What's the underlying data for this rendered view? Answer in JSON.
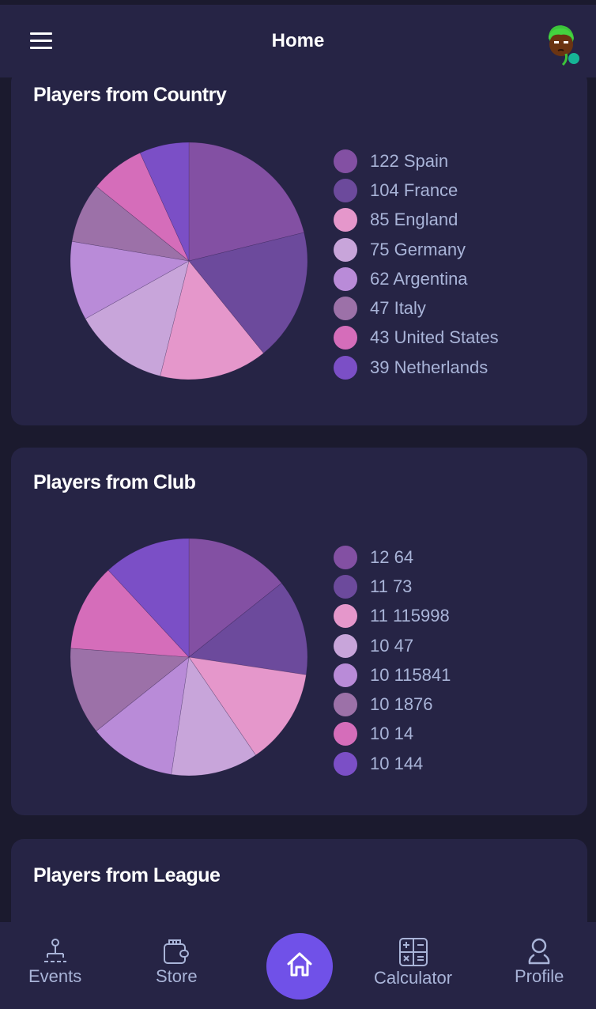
{
  "header": {
    "title": "Home",
    "menu_icon": "hamburger-icon",
    "avatar_icon": "user-avatar",
    "online_status_color": "#16b596"
  },
  "cards": [
    {
      "title": "Players from Country"
    },
    {
      "title": "Players from Club"
    },
    {
      "title": "Players from League"
    }
  ],
  "nav": {
    "items": [
      {
        "label": "Events",
        "icon": "events-icon"
      },
      {
        "label": "Store",
        "icon": "wallet-icon"
      },
      {
        "label": "Home",
        "icon": "home-icon"
      },
      {
        "label": "Calculator",
        "icon": "calculator-icon"
      },
      {
        "label": "Profile",
        "icon": "profile-icon"
      }
    ],
    "active": "Home",
    "accent": "#7051e8"
  },
  "chart_data": [
    {
      "type": "pie",
      "title": "Players from Country",
      "categories": [
        "Spain",
        "France",
        "England",
        "Germany",
        "Argentina",
        "Italy",
        "United States",
        "Netherlands"
      ],
      "values": [
        122,
        104,
        85,
        75,
        62,
        47,
        43,
        39
      ],
      "legend_labels": [
        "122 Spain",
        "104 France",
        "85 England",
        "75 Germany",
        "62 Argentina",
        "47 Italy",
        "43 United States",
        "39 Netherlands"
      ],
      "colors": [
        "#8350a3",
        "#6c4a9c",
        "#e597cb",
        "#c8a5da",
        "#b98bd8",
        "#9c71a8",
        "#d56dba",
        "#7b4fc6"
      ],
      "legend": "right"
    },
    {
      "type": "pie",
      "title": "Players from Club",
      "categories": [
        "64",
        "73",
        "115998",
        "47",
        "115841",
        "1876",
        "14",
        "144"
      ],
      "values": [
        12,
        11,
        11,
        10,
        10,
        10,
        10,
        10
      ],
      "legend_labels": [
        "12 64",
        "11 73",
        "11 115998",
        "10 47",
        "10 115841",
        "10 1876",
        "10 14",
        "10 144"
      ],
      "colors": [
        "#8350a3",
        "#6c4a9c",
        "#e597cb",
        "#c8a5da",
        "#b98bd8",
        "#9c71a8",
        "#d56dba",
        "#7b4fc6"
      ],
      "legend": "right"
    }
  ]
}
